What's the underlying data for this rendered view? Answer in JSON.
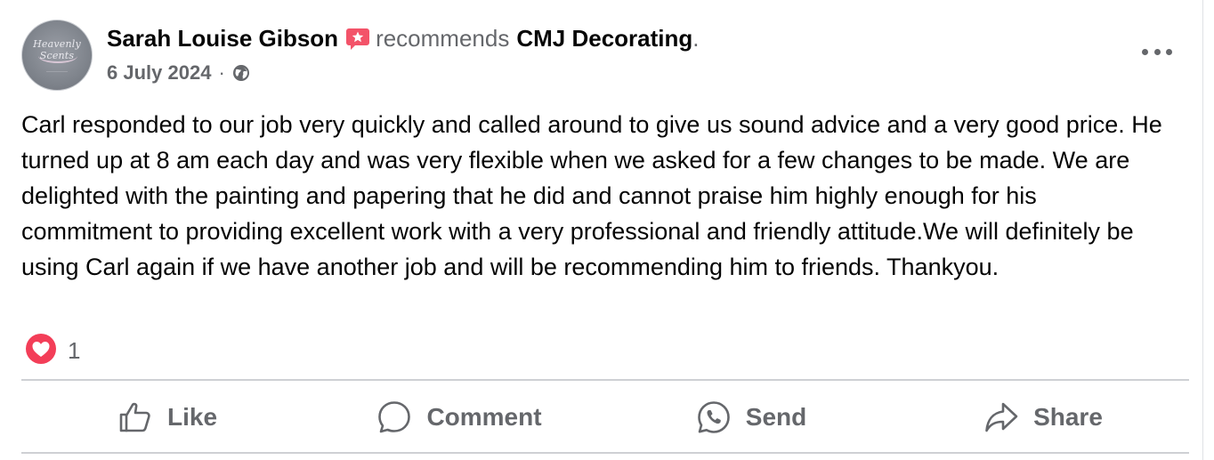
{
  "post": {
    "author": "Sarah Louise Gibson",
    "recommends": "recommends",
    "page_name": "CMJ Decorating",
    "period": ".",
    "date": "6 July 2024",
    "separator": "·",
    "privacy_icon": "globe-icon",
    "avatar_text": "Heavenly Scents",
    "body": "Carl responded to our job very quickly and called around to give us sound advice and a very good price. He turned up at 8 am each day and was very flexible when we asked for a few changes to be made. We are delighted with the painting and papering that he did and cannot praise him highly enough for his commitment to providing excellent work with a very professional and friendly attitude.We will definitely be using Carl again if we have another job and will be recommending him to friends. Thankyou.",
    "reaction_icon": "love-reaction-icon",
    "reaction_count": "1"
  },
  "actions": {
    "like": {
      "label": "Like",
      "icon": "thumbs-up-icon"
    },
    "comment": {
      "label": "Comment",
      "icon": "comment-bubble-icon"
    },
    "send": {
      "label": "Send",
      "icon": "whatsapp-icon"
    },
    "share": {
      "label": "Share",
      "icon": "share-arrow-icon"
    }
  },
  "colors": {
    "secondary_text": "#65676b",
    "primary_text": "#050505",
    "divider": "#ced0d4",
    "recommend_badge": "#f35369",
    "love_reaction": "#f33e58"
  }
}
